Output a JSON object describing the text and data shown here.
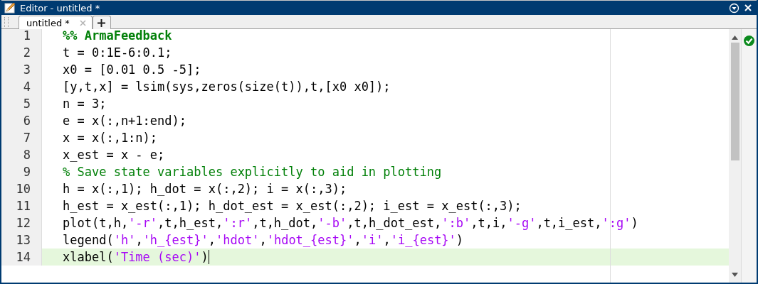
{
  "window": {
    "title": "Editor - untitled *"
  },
  "tabs": [
    {
      "label": "untitled *",
      "selected": true
    }
  ],
  "editor": {
    "lines": [
      {
        "number": "1",
        "current": false,
        "tokens": [
          {
            "kind": "section",
            "text": "%% ArmaFeedback"
          }
        ]
      },
      {
        "number": "2",
        "current": false,
        "tokens": [
          {
            "kind": "code",
            "text": "t = 0:1E-6:0.1;"
          }
        ]
      },
      {
        "number": "3",
        "current": false,
        "tokens": [
          {
            "kind": "code",
            "text": "x0 = [0.01 0.5 -5];"
          }
        ]
      },
      {
        "number": "4",
        "current": false,
        "tokens": [
          {
            "kind": "code",
            "text": "[y,t,x] = lsim(sys,zeros(size(t)),t,[x0 x0]);"
          }
        ]
      },
      {
        "number": "5",
        "current": false,
        "tokens": [
          {
            "kind": "code",
            "text": "n = 3;"
          }
        ]
      },
      {
        "number": "6",
        "current": false,
        "tokens": [
          {
            "kind": "code",
            "text": "e = x(:,n+1:end);"
          }
        ]
      },
      {
        "number": "7",
        "current": false,
        "tokens": [
          {
            "kind": "code",
            "text": "x = x(:,1:n);"
          }
        ]
      },
      {
        "number": "8",
        "current": false,
        "tokens": [
          {
            "kind": "code",
            "text": "x_est = x - e;"
          }
        ]
      },
      {
        "number": "9",
        "current": false,
        "tokens": [
          {
            "kind": "comment",
            "text": "% Save state variables explicitly to aid in plotting"
          }
        ]
      },
      {
        "number": "10",
        "current": false,
        "tokens": [
          {
            "kind": "code",
            "text": "h = x(:,1); h_dot = x(:,2); i = x(:,3);"
          }
        ]
      },
      {
        "number": "11",
        "current": false,
        "tokens": [
          {
            "kind": "code",
            "text": "h_est = x_est(:,1); h_dot_est = x_est(:,2); i_est = x_est(:,3);"
          }
        ]
      },
      {
        "number": "12",
        "current": false,
        "tokens": [
          {
            "kind": "code",
            "text": "plot(t,h,"
          },
          {
            "kind": "string",
            "text": "'-r'"
          },
          {
            "kind": "code",
            "text": ",t,h_est,"
          },
          {
            "kind": "string",
            "text": "':r'"
          },
          {
            "kind": "code",
            "text": ",t,h_dot,"
          },
          {
            "kind": "string",
            "text": "'-b'"
          },
          {
            "kind": "code",
            "text": ",t,h_dot_est,"
          },
          {
            "kind": "string",
            "text": "':b'"
          },
          {
            "kind": "code",
            "text": ",t,i,"
          },
          {
            "kind": "string",
            "text": "'-g'"
          },
          {
            "kind": "code",
            "text": ",t,i_est,"
          },
          {
            "kind": "string",
            "text": "':g'"
          },
          {
            "kind": "code",
            "text": ")"
          }
        ]
      },
      {
        "number": "13",
        "current": false,
        "tokens": [
          {
            "kind": "code",
            "text": "legend("
          },
          {
            "kind": "string",
            "text": "'h'"
          },
          {
            "kind": "code",
            "text": ","
          },
          {
            "kind": "string",
            "text": "'h_{est}'"
          },
          {
            "kind": "code",
            "text": ","
          },
          {
            "kind": "string",
            "text": "'hdot'"
          },
          {
            "kind": "code",
            "text": ","
          },
          {
            "kind": "string",
            "text": "'hdot_{est}'"
          },
          {
            "kind": "code",
            "text": ","
          },
          {
            "kind": "string",
            "text": "'i'"
          },
          {
            "kind": "code",
            "text": ","
          },
          {
            "kind": "string",
            "text": "'i_{est}'"
          },
          {
            "kind": "code",
            "text": ")"
          }
        ]
      },
      {
        "number": "14",
        "current": true,
        "tokens": [
          {
            "kind": "code",
            "text": "xlabel("
          },
          {
            "kind": "string",
            "text": "'Time (sec)'"
          },
          {
            "kind": "code",
            "text": ")"
          }
        ]
      }
    ]
  }
}
